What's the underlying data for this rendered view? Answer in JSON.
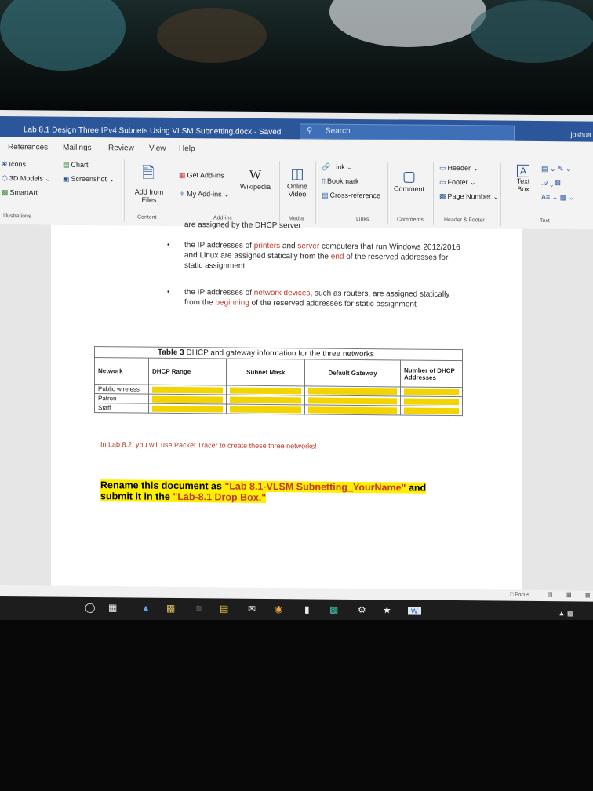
{
  "window": {
    "title": "Lab 8.1 Design Three IPv4 Subnets Using VLSM Subnetting.docx - Saved",
    "search_placeholder": "Search",
    "user": "joshua"
  },
  "menu": [
    "References",
    "Mailings",
    "Review",
    "View",
    "Help"
  ],
  "ribbon": {
    "illustrations": {
      "items": [
        "Icons",
        "3D Models",
        "SmartArt",
        "Chart",
        "Screenshot"
      ],
      "group": "Illustrations"
    },
    "content": {
      "add_from_files": "Add from Files",
      "group": "Content"
    },
    "addins": {
      "get": "Get Add-ins",
      "my": "My Add-ins",
      "wikipedia": "Wikipedia",
      "group": "Add-ins"
    },
    "media": {
      "online_video": "Online Video",
      "group": "Media"
    },
    "links": {
      "link": "Link",
      "bookmark": "Bookmark",
      "cross_reference": "Cross-reference",
      "group": "Links"
    },
    "comments": {
      "comment": "Comment",
      "group": "Comments"
    },
    "header_footer": {
      "header": "Header",
      "footer": "Footer",
      "page_number": "Page Number",
      "group": "Header & Footer"
    },
    "text": {
      "text_box": "Text Box",
      "group": "Text"
    }
  },
  "document": {
    "top_line": "are assigned by the DHCP server",
    "bullet1": {
      "pre": "the IP addresses of ",
      "r1": "printers",
      "mid1": " and ",
      "r2": "server",
      "mid2": " computers that run Windows 2012/2016 and Linux are assigned statically from the ",
      "r3": "end",
      "post": " of the reserved addresses for static assignment"
    },
    "bullet2": {
      "pre": "the IP addresses of ",
      "r1": "network devices",
      "mid": ", such as routers, are assigned statically from the ",
      "r2": "beginning",
      "post": " of the reserved addresses for static assignment"
    },
    "table": {
      "caption_bold": "Table 3",
      "caption_rest": " DHCP and gateway information for the three networks",
      "headers": [
        "Network",
        "DHCP Range",
        "Subnet Mask",
        "Default Gateway",
        "Number of DHCP Addresses"
      ],
      "rows": [
        "Public wireless",
        "Patron",
        "Staff"
      ]
    },
    "note": "In Lab 8.2, you will use Packet Tracer to create these three networks!",
    "rename": {
      "pre": "Rename this document as ",
      "q1": "\"Lab 8.1-VLSM Subnetting_YourName\"",
      "mid": " and submit it in the ",
      "q2": "\"Lab-8.1 Drop Box.\""
    }
  },
  "status": {
    "focus": "Focus"
  },
  "colors": {
    "title_blue": "#2b579a",
    "highlight": "#f2d500",
    "red_text": "#c0392b",
    "orange_text": "#c0392b"
  }
}
